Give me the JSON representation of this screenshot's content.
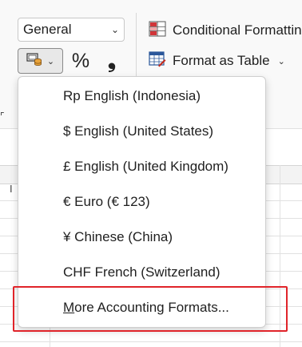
{
  "number_format": {
    "selected": "General",
    "chevron_icon": "chevron-down-icon"
  },
  "accounting_button": {
    "icon": "accounting-number-format-icon",
    "chevron_icon": "chevron-down-icon"
  },
  "percent_button": {
    "label": "%"
  },
  "comma_button": {
    "label": "❟"
  },
  "styles": {
    "conditional_formatting": "Conditional Formatting",
    "format_as_table": "Format as Table",
    "chevron_icon": "chevron-down-icon"
  },
  "sheet": {
    "header_mark": "I"
  },
  "menu": {
    "items": [
      {
        "label": "Rp English (Indonesia)"
      },
      {
        "label": "$ English (United States)"
      },
      {
        "label": "£ English (United Kingdom)"
      },
      {
        "label": "€ Euro (€ 123)"
      },
      {
        "label": "¥ Chinese (China)"
      },
      {
        "label": "CHF French (Switzerland)"
      }
    ],
    "more": {
      "underlined_letter": "M",
      "rest": "ore Accounting Formats..."
    }
  },
  "colors": {
    "highlight": "#e0242a",
    "accent_red": "#c42b1c",
    "accent_blue": "#2b579a"
  }
}
